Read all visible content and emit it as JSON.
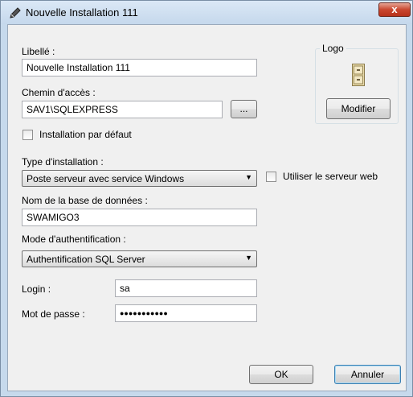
{
  "window": {
    "title": "Nouvelle Installation 111",
    "close_symbol": "x",
    "title_icon": "pencil-icon"
  },
  "form": {
    "libelle_label": "Libellé :",
    "libelle_value": "Nouvelle Installation 111",
    "chemin_label": "Chemin d'accès :",
    "chemin_value": "SAV1\\SQLEXPRESS",
    "browse_label": "...",
    "default_install_label": "Installation par défaut",
    "default_install_checked": false,
    "type_label": "Type d'installation :",
    "type_value": "Poste serveur avec service Windows",
    "web_server_label": "Utiliser le serveur web",
    "web_server_checked": false,
    "db_label": "Nom de la base de données :",
    "db_value": "SWAMIGO3",
    "auth_label": "Mode d'authentification :",
    "auth_value": "Authentification SQL Server",
    "login_label": "Login :",
    "login_value": "sa",
    "password_label": "Mot de passe :",
    "password_mask": "●●●●●●●●●●●"
  },
  "logo": {
    "group_label": "Logo",
    "icon": "filing-cabinet-icon",
    "modify_label": "Modifier"
  },
  "footer": {
    "ok_label": "OK",
    "cancel_label": "Annuler"
  },
  "colors": {
    "frame": "#c6d9ec",
    "client": "#f0f0f0",
    "close_button": "#c9472f",
    "focus_border": "#3c7fb1"
  }
}
